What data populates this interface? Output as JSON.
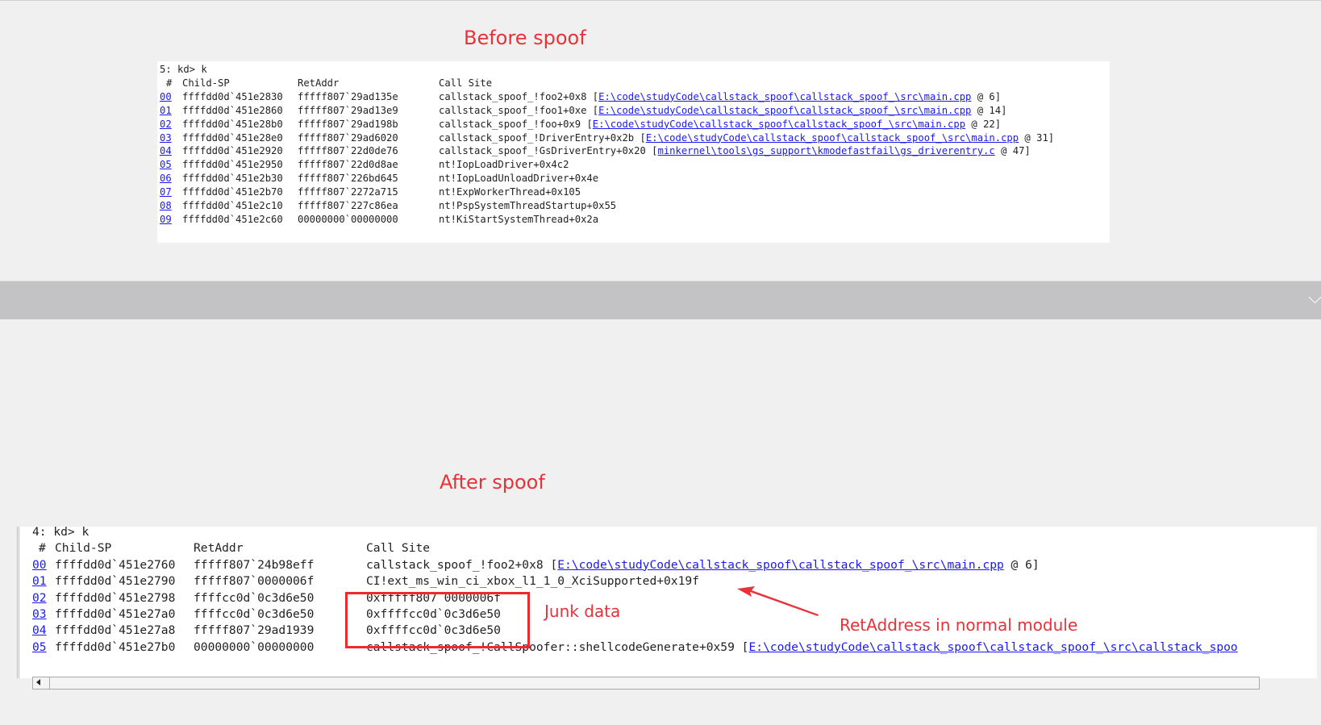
{
  "before": {
    "caption": "Before spoof",
    "prompt": "5: kd> k",
    "headers": {
      "num": "#",
      "child_sp": "Child-SP",
      "ret_addr": "RetAddr",
      "call_site": "Call Site"
    },
    "rows": [
      {
        "num": "00",
        "child_sp": "ffffdd0d`451e2830",
        "ret_addr": "fffff807`29ad135e",
        "call_site": "callstack_spoof_!foo2+0x8",
        "src": "E:\\code\\studyCode\\callstack_spoof\\callstack_spoof_\\src\\main.cpp",
        "line": " @ 6]"
      },
      {
        "num": "01",
        "child_sp": "ffffdd0d`451e2860",
        "ret_addr": "fffff807`29ad13e9",
        "call_site": "callstack_spoof_!foo1+0xe",
        "src": "E:\\code\\studyCode\\callstack_spoof\\callstack_spoof_\\src\\main.cpp",
        "line": " @ 14]"
      },
      {
        "num": "02",
        "child_sp": "ffffdd0d`451e28b0",
        "ret_addr": "fffff807`29ad198b",
        "call_site": "callstack_spoof_!foo+0x9",
        "src": "E:\\code\\studyCode\\callstack_spoof\\callstack_spoof_\\src\\main.cpp",
        "line": " @ 22]"
      },
      {
        "num": "03",
        "child_sp": "ffffdd0d`451e28e0",
        "ret_addr": "fffff807`29ad6020",
        "call_site": "callstack_spoof_!DriverEntry+0x2b",
        "src": "E:\\code\\studyCode\\callstack_spoof\\callstack_spoof_\\src\\main.cpp",
        "line": " @ 31]"
      },
      {
        "num": "04",
        "child_sp": "ffffdd0d`451e2920",
        "ret_addr": "fffff807`22d0de76",
        "call_site": "callstack_spoof_!GsDriverEntry+0x20",
        "src": "minkernel\\tools\\gs_support\\kmodefastfail\\gs_driverentry.c",
        "line": " @ 47]"
      },
      {
        "num": "05",
        "child_sp": "ffffdd0d`451e2950",
        "ret_addr": "fffff807`22d0d8ae",
        "call_site": "nt!IopLoadDriver+0x4c2"
      },
      {
        "num": "06",
        "child_sp": "ffffdd0d`451e2b30",
        "ret_addr": "fffff807`226bd645",
        "call_site": "nt!IopLoadUnloadDriver+0x4e"
      },
      {
        "num": "07",
        "child_sp": "ffffdd0d`451e2b70",
        "ret_addr": "fffff807`2272a715",
        "call_site": "nt!ExpWorkerThread+0x105"
      },
      {
        "num": "08",
        "child_sp": "ffffdd0d`451e2c10",
        "ret_addr": "fffff807`227c86ea",
        "call_site": "nt!PspSystemThreadStartup+0x55"
      },
      {
        "num": "09",
        "child_sp": "ffffdd0d`451e2c60",
        "ret_addr": "00000000`00000000",
        "call_site": "nt!KiStartSystemThread+0x2a"
      }
    ]
  },
  "after": {
    "caption": "After spoof",
    "prompt": "4: kd> k",
    "headers": {
      "num": "#",
      "child_sp": "Child-SP",
      "ret_addr": "RetAddr",
      "call_site": "Call Site"
    },
    "rows": [
      {
        "num": "00",
        "child_sp": "ffffdd0d`451e2760",
        "ret_addr": "fffff807`24b98eff",
        "call_site": "callstack_spoof_!foo2+0x8",
        "src": "E:\\code\\studyCode\\callstack_spoof\\callstack_spoof_\\src\\main.cpp",
        "line": " @ 6]"
      },
      {
        "num": "01",
        "child_sp": "ffffdd0d`451e2790",
        "ret_addr": "fffff807`0000006f",
        "call_site": "CI!ext_ms_win_ci_xbox_l1_1_0_XciSupported+0x19f"
      },
      {
        "num": "02",
        "child_sp": "ffffdd0d`451e2798",
        "ret_addr": "ffffcc0d`0c3d6e50",
        "call_site": "0xfffff807`0000006f"
      },
      {
        "num": "03",
        "child_sp": "ffffdd0d`451e27a0",
        "ret_addr": "ffffcc0d`0c3d6e50",
        "call_site": "0xffffcc0d`0c3d6e50"
      },
      {
        "num": "04",
        "child_sp": "ffffdd0d`451e27a8",
        "ret_addr": "fffff807`29ad1939",
        "call_site": "0xffffcc0d`0c3d6e50"
      },
      {
        "num": "05",
        "child_sp": "ffffdd0d`451e27b0",
        "ret_addr": "00000000`00000000",
        "call_site": "callstack_spoof_!CallSpoofer::shellcodeGenerate+0x59",
        "src": "E:\\code\\studyCode\\callstack_spoof\\callstack_spoof_\\src\\callstack_spoo"
      }
    ],
    "annotations": {
      "junk": "Junk data",
      "retaddr": "RetAddress in normal module"
    }
  },
  "colors": {
    "annotation": "#e8323a",
    "link": "#1a1aee"
  }
}
